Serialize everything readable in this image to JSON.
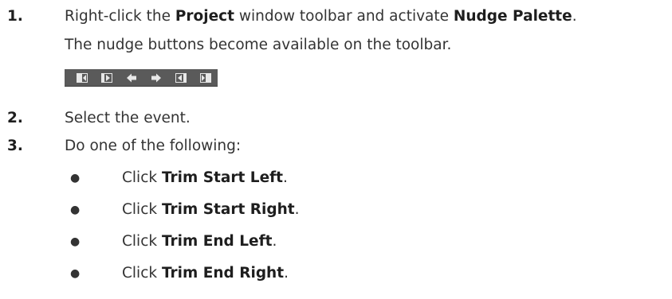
{
  "steps": [
    {
      "number": "1.",
      "line1": {
        "pre": "Right-click the ",
        "bold1": "Project",
        "mid": " window toolbar and activate ",
        "bold2": "Nudge Palette",
        "post": "."
      },
      "line2": "The nudge buttons become available on the toolbar."
    },
    {
      "number": "2.",
      "text": "Select the event."
    },
    {
      "number": "3.",
      "text": "Do one of the following:"
    }
  ],
  "bullets": [
    {
      "symbol": "●",
      "pre": "Click ",
      "bold": "Trim Start Left",
      "post": "."
    },
    {
      "symbol": "●",
      "pre": "Click ",
      "bold": "Trim Start Right",
      "post": "."
    },
    {
      "symbol": "●",
      "pre": "Click ",
      "bold": "Trim End Left",
      "post": "."
    },
    {
      "symbol": "●",
      "pre": "Click ",
      "bold": "Trim End Right",
      "post": "."
    }
  ],
  "toolbar": {
    "background": "#5a5a5a",
    "icon_color": "#e8e8e8",
    "buttons": [
      {
        "icon": "trim-start-left-icon"
      },
      {
        "icon": "trim-start-right-icon"
      },
      {
        "icon": "nudge-left-icon"
      },
      {
        "icon": "nudge-right-icon"
      },
      {
        "icon": "trim-end-left-icon"
      },
      {
        "icon": "trim-end-right-icon"
      }
    ]
  }
}
